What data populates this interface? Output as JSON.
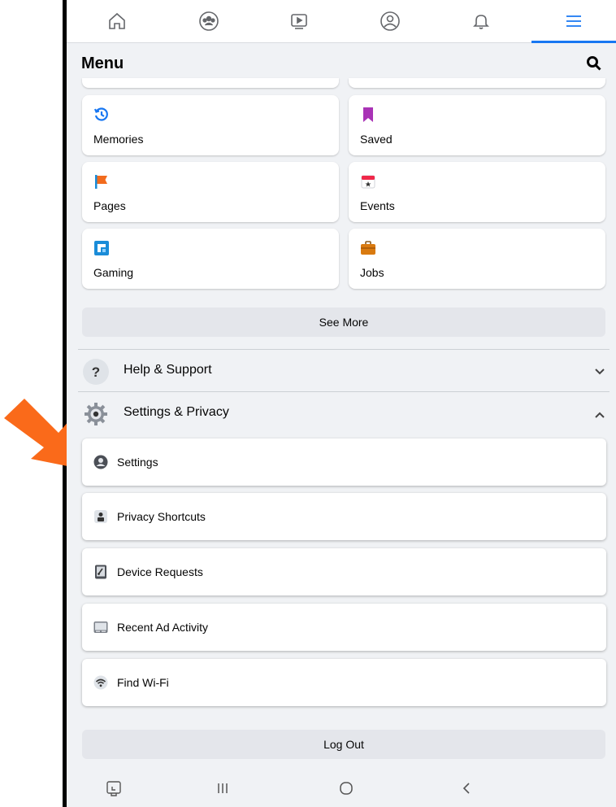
{
  "header": {
    "title": "Menu"
  },
  "shortcuts": [
    {
      "label": "Memories",
      "icon": "memories-icon",
      "color": "#1877f2"
    },
    {
      "label": "Saved",
      "icon": "saved-icon",
      "color": "#a933b6"
    },
    {
      "label": "Pages",
      "icon": "pages-flag-icon",
      "color": "#f26b1d"
    },
    {
      "label": "Events",
      "icon": "events-calendar-icon",
      "color": "#f0284a"
    },
    {
      "label": "Gaming",
      "icon": "gaming-icon",
      "color": "#1a8cd8"
    },
    {
      "label": "Jobs",
      "icon": "jobs-briefcase-icon",
      "color": "#d97a0f"
    }
  ],
  "see_more_label": "See More",
  "help": {
    "label": "Help & Support"
  },
  "settings_privacy": {
    "label": "Settings & Privacy",
    "items": [
      {
        "label": "Settings",
        "icon": "account-settings-icon"
      },
      {
        "label": "Privacy Shortcuts",
        "icon": "privacy-lock-icon"
      },
      {
        "label": "Device Requests",
        "icon": "device-phone-icon"
      },
      {
        "label": "Recent Ad Activity",
        "icon": "ad-activity-icon"
      },
      {
        "label": "Find Wi-Fi",
        "icon": "wifi-icon"
      }
    ]
  },
  "logout_label": "Log Out",
  "accent_color": "#1877f2",
  "highlight_arrow_color": "#fa6a1a"
}
